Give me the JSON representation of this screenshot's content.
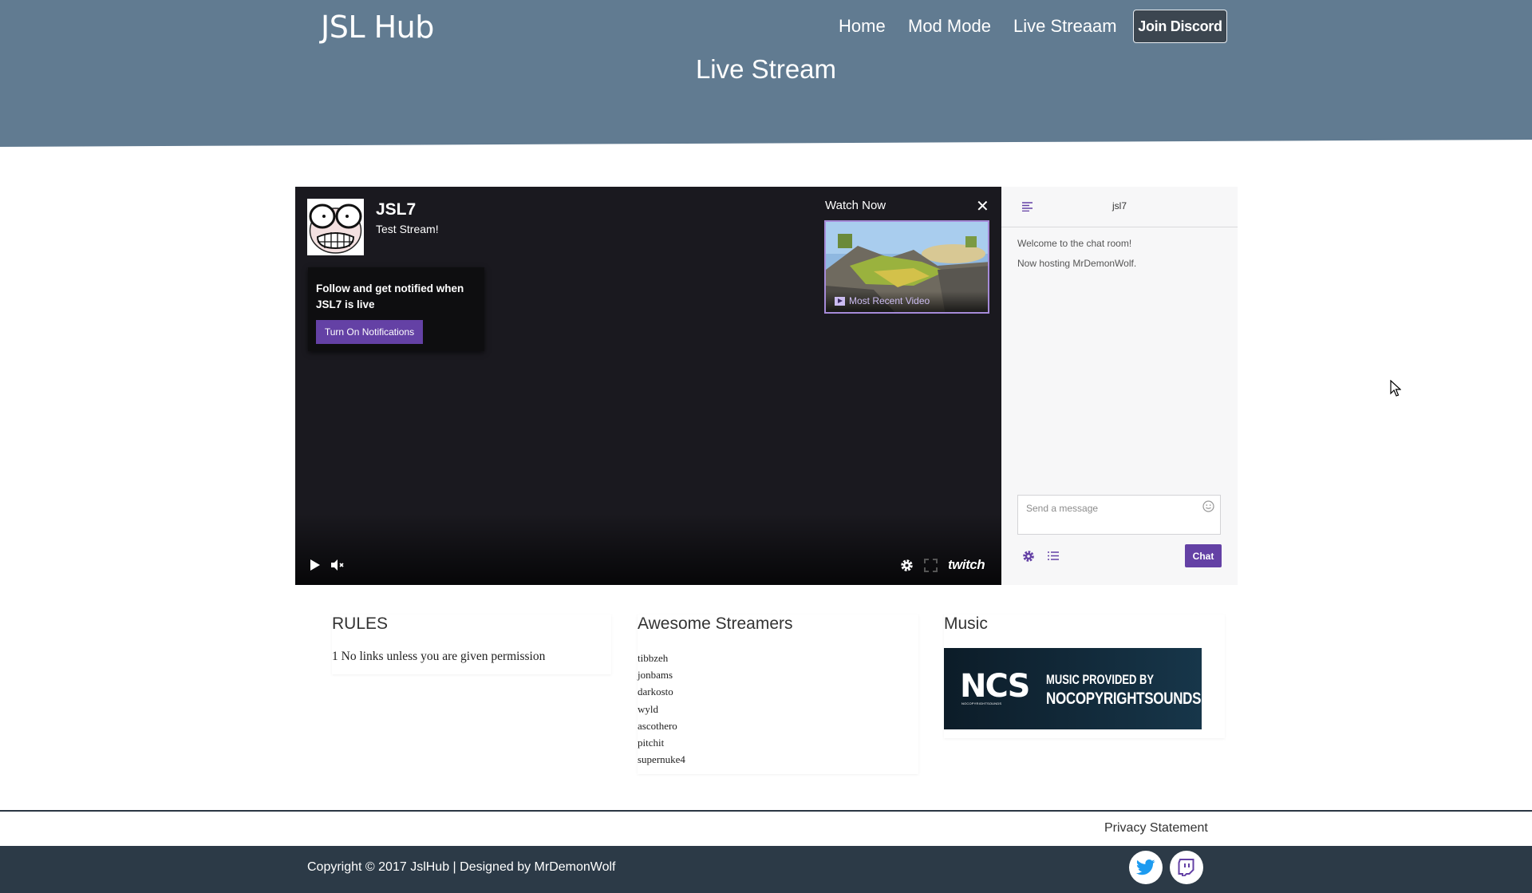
{
  "header": {
    "brand": "JSL Hub",
    "nav": [
      "Home",
      "Mod Mode",
      "Live Streaam"
    ],
    "discord_label": "Join Discord",
    "page_title": "Live Stream"
  },
  "player": {
    "channel_name": "JSL7",
    "stream_title": "Test Stream!",
    "follow_text": "Follow and get notified when JSL7 is live",
    "notif_button": "Turn On Notifications",
    "watch_now": "Watch Now",
    "close_symbol": "✕",
    "recent_video": "Most Recent Video",
    "twitch_logo_text": "twitch",
    "icons": [
      "play-icon",
      "mute-icon",
      "settings-icon",
      "fullscreen-icon",
      "twitch-logo"
    ]
  },
  "chat": {
    "channel": "jsl7",
    "messages": [
      "Welcome to the chat room!",
      "Now hosting MrDemonWolf."
    ],
    "placeholder": "Send a message",
    "send_label": "Chat",
    "icons": [
      "collapse-icon",
      "emoji-icon",
      "settings-icon",
      "list-icon"
    ]
  },
  "rules": {
    "title": "RULES",
    "items": [
      "1 No links unless you are given permission"
    ]
  },
  "streamers": {
    "title": "Awesome Streamers",
    "items": [
      "tibbzeh",
      "jonbams",
      "darkosto",
      "wyld",
      "ascothero",
      "pitchit",
      "supernuke4"
    ]
  },
  "music": {
    "title": "Music",
    "banner_logo": "NCS",
    "banner_logo_small": "NOCOPYRIGHTSOUNDS",
    "banner_line1": "MUSIC PROVIDED BY",
    "banner_line2": "NOCOPYRIGHTSOUNDS"
  },
  "footer": {
    "privacy": "Privacy Statement",
    "copyright": "Copyright © 2017 JslHub | Designed by MrDemonWolf",
    "social": [
      "twitter-icon",
      "twitch-icon"
    ]
  },
  "colors": {
    "header_bg": "#617b91",
    "twitch_purple": "#6441a5",
    "footer_bg": "#2c3a47",
    "player_bg": "#1a191f"
  }
}
